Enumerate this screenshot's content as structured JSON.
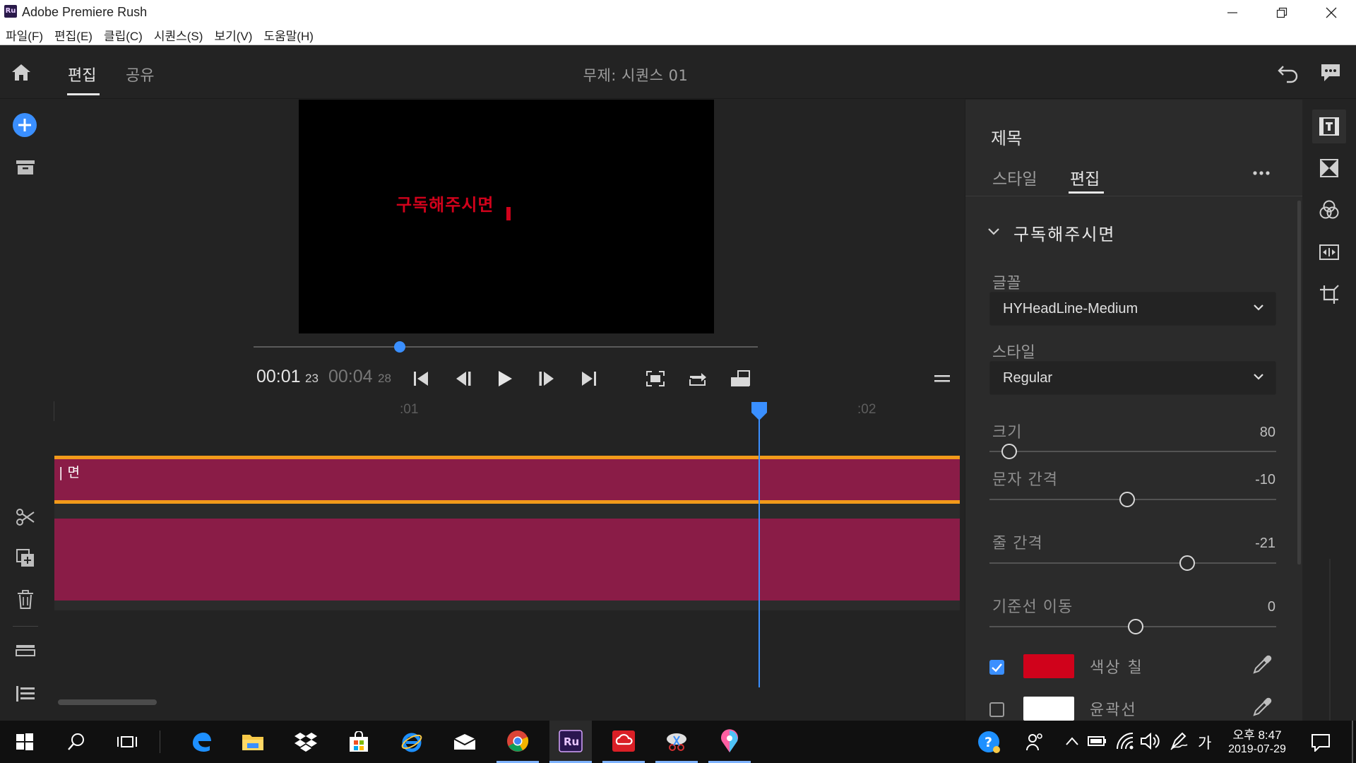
{
  "window": {
    "title": "Adobe Premiere Rush",
    "logo": "Ru"
  },
  "menu": [
    "파일(F)",
    "편집(E)",
    "클립(C)",
    "시퀀스(S)",
    "보기(V)",
    "도움말(H)"
  ],
  "header": {
    "tabs": [
      {
        "label": "편집",
        "active": true
      },
      {
        "label": "공유",
        "active": false
      }
    ],
    "project_title": "무제: 시퀀스 01"
  },
  "preview": {
    "overlay_text": "구독해주시면",
    "text_color": "#d0021b"
  },
  "playback": {
    "current": "00:01",
    "current_frames": "23",
    "duration": "00:04",
    "duration_frames": "28",
    "progress": 0.29
  },
  "timeline": {
    "ruler_labels": [
      ":01",
      ":02"
    ],
    "title_clip_label": "| 면",
    "clip_color": "#8a1c47",
    "selection_color": "#f29a1a",
    "playhead_color": "#3a8fff"
  },
  "panel": {
    "title": "제목",
    "tabs": [
      {
        "label": "스타일",
        "active": false
      },
      {
        "label": "편집",
        "active": true
      }
    ],
    "section_name": "구독해주시면",
    "font_label": "글꼴",
    "font_value": "HYHeadLine-Medium",
    "style_label": "스타일",
    "style_value": "Regular",
    "sliders": [
      {
        "label": "크기",
        "value": "80",
        "position": 0.07
      },
      {
        "label": "문자 간격",
        "value": "-10",
        "position": 0.48
      },
      {
        "label": "줄 간격",
        "value": "-21",
        "position": 0.69
      },
      {
        "label": "기준선 이동",
        "value": "0",
        "position": 0.51
      }
    ],
    "fill": {
      "label": "색상 칠",
      "checked": true,
      "color": "#d0021b"
    },
    "stroke": {
      "label": "윤곽선",
      "checked": false,
      "color": "#ffffff"
    }
  },
  "taskbar": {
    "time": "오후 8:47",
    "date": "2019-07-29",
    "ime": "가"
  },
  "accent": "#3a8fff"
}
